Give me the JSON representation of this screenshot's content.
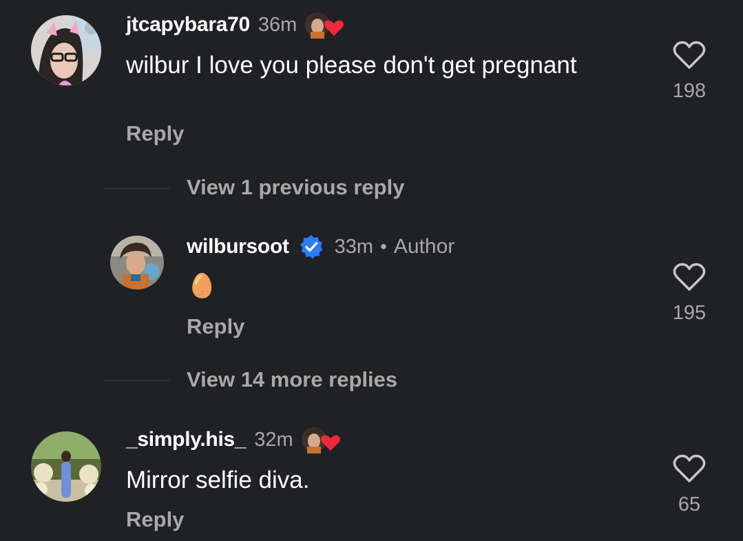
{
  "comments": [
    {
      "username": "jtcapybara70",
      "time": "36m",
      "text": "wilbur I love you please don't get pregnant",
      "reply_label": "Reply",
      "likes": "198",
      "author_liked": true
    },
    {
      "username": "wilbursoot",
      "verified": true,
      "time": "33m",
      "separator": "•",
      "author_label": "Author",
      "text": "🥚",
      "reply_label": "Reply",
      "likes": "195"
    },
    {
      "username": "_simply.his_",
      "time": "32m",
      "text": "Mirror selfie diva.",
      "reply_label": "Reply",
      "likes": "65",
      "author_liked": true
    }
  ],
  "thread": {
    "view_previous": "View 1 previous reply",
    "view_more": "View 14 more replies"
  },
  "icons": {
    "like": "heart-outline-icon",
    "verified": "verified-badge-icon",
    "author_liked": "author-liked-heart-icon"
  },
  "colors": {
    "background": "#202124",
    "text_primary": "#ffffff",
    "text_secondary": "#a8a8a8",
    "verified_blue": "#2b7cf5",
    "liked_heart": "#f0283c"
  }
}
